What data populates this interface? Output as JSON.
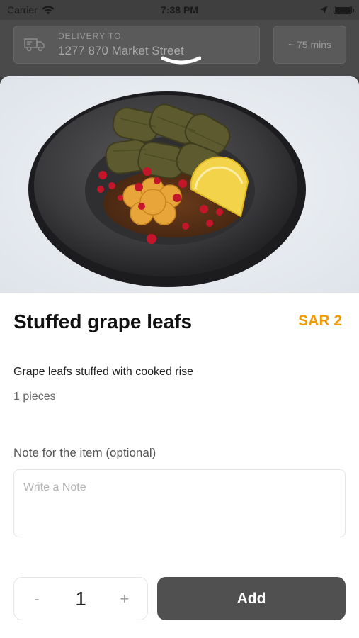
{
  "status_bar": {
    "carrier": "Carrier",
    "time": "7:38 PM"
  },
  "header": {
    "delivery_label": "DELIVERY TO",
    "delivery_address": "1277 870 Market Street",
    "eta": "~ 75 mins"
  },
  "item": {
    "image_icon": "stuffed-grape-leaves-photo",
    "title": "Stuffed grape leafs",
    "price": "SAR 2",
    "price_color": "#f29a00",
    "description": "Grape leafs stuffed with cooked rise",
    "pieces": "1 pieces"
  },
  "note": {
    "label": "Note for the item (optional)",
    "placeholder": "Write a Note",
    "value": ""
  },
  "cart": {
    "minus_label": "-",
    "quantity": "1",
    "plus_label": "+",
    "add_label": "Add"
  }
}
